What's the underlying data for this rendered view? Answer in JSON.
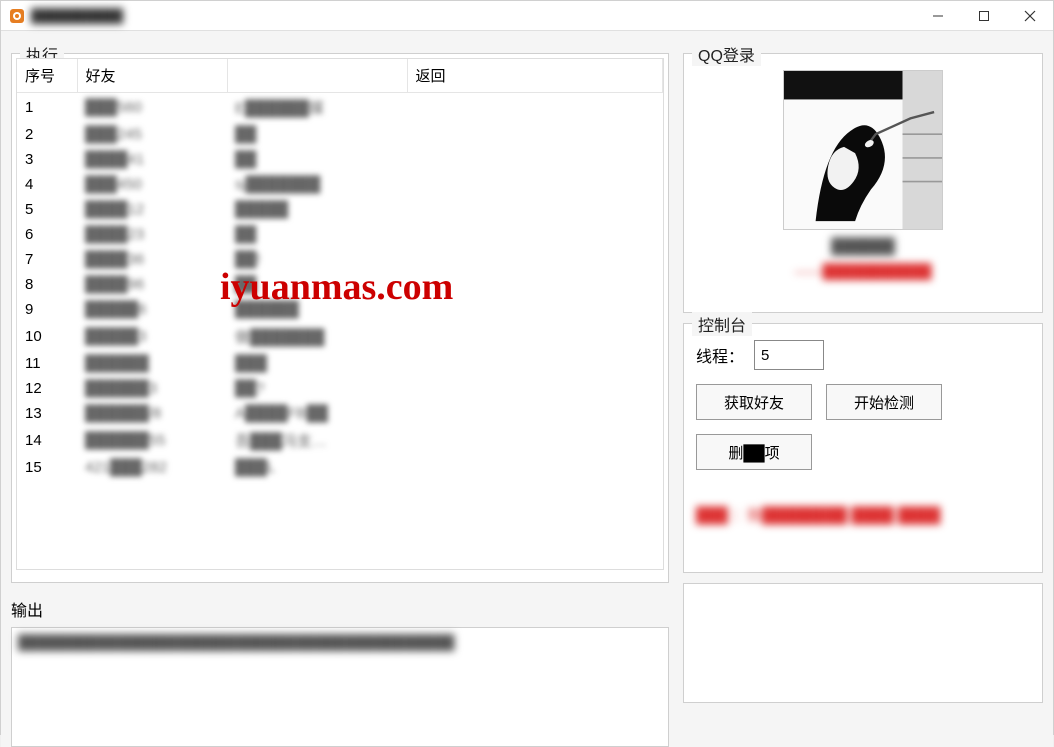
{
  "window": {
    "title": "██████████"
  },
  "watermark": "iyuanmas.com",
  "exec": {
    "title": "执行",
    "columns": {
      "seq": "序号",
      "friend": "好友",
      "nick": "",
      "ret": "返回"
    },
    "rows": [
      {
        "seq": "1",
        "friend": "███560",
        "nick": "E██████媒"
      },
      {
        "seq": "2",
        "friend": "███245",
        "nick": "██"
      },
      {
        "seq": "3",
        "friend": "████41",
        "nick": "██"
      },
      {
        "seq": "4",
        "friend": "███450",
        "nick": "sj███████"
      },
      {
        "seq": "5",
        "friend": "████12",
        "nick": "█████"
      },
      {
        "seq": "6",
        "friend": "████23",
        "nick": "██"
      },
      {
        "seq": "7",
        "friend": "████36",
        "nick": "██!"
      },
      {
        "seq": "8",
        "friend": "████96",
        "nick": "██"
      },
      {
        "seq": "9",
        "friend": "█████6",
        "nick": "██████"
      },
      {
        "seq": "10",
        "friend": "█████3",
        "nick": "做███████"
      },
      {
        "seq": "11",
        "friend": "██████",
        "nick": "███"
      },
      {
        "seq": "12",
        "friend": "██████3",
        "nick": "██?"
      },
      {
        "seq": "13",
        "friend": "██████/8",
        "nick": "A████FB██"
      },
      {
        "seq": "14",
        "friend": "██████55",
        "nick": "吾███冯支…"
      },
      {
        "seq": "15",
        "friend": "421███282",
        "nick": "███L"
      }
    ]
  },
  "output": {
    "title": "输出",
    "lines": [
      "████████████████████████████████████████████"
    ]
  },
  "login": {
    "title": "QQ登录",
    "username": "██████",
    "subtitle": "——███████████"
  },
  "control": {
    "title": "控制台",
    "thread_label": "线程：",
    "thread_value": "5",
    "btn_fetch": "获取好友",
    "btn_start": "开始检测",
    "btn_delete": "删██项",
    "bottom_text": "███ ：致████████ ████ ████"
  }
}
